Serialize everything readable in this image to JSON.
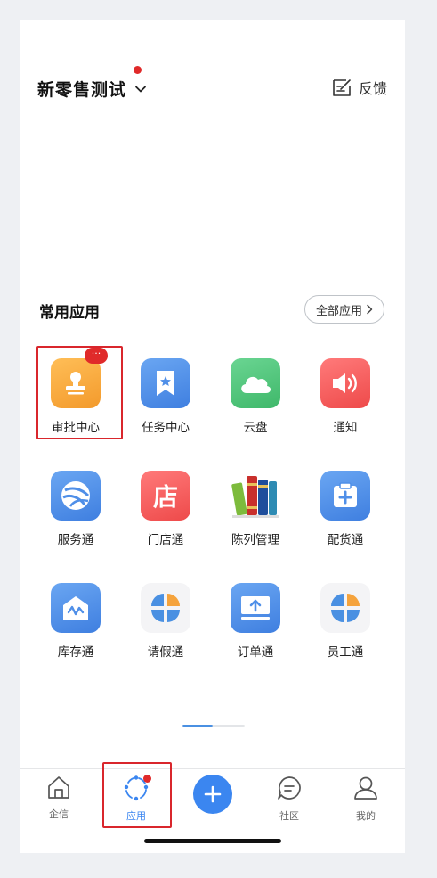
{
  "header": {
    "org_name": "新零售测试",
    "feedback_label": "反馈"
  },
  "section": {
    "title": "常用应用",
    "all_apps_label": "全部应用"
  },
  "apps": [
    {
      "label": "审批中心",
      "icon": "approval-stamp-icon",
      "color": "#f5a73c",
      "badge": "···"
    },
    {
      "label": "任务中心",
      "icon": "task-bookmark-icon",
      "color": "#4f8fe8"
    },
    {
      "label": "云盘",
      "icon": "cloud-icon",
      "color": "#52c47d"
    },
    {
      "label": "通知",
      "icon": "speaker-icon",
      "color": "#f25a5a"
    },
    {
      "label": "服务通",
      "icon": "service-globe-icon",
      "color": "#4f8fe8"
    },
    {
      "label": "门店通",
      "icon": "store-icon",
      "color": "#f25a5a",
      "glyph": "店"
    },
    {
      "label": "陈列管理",
      "icon": "books-icon",
      "color": "#ffffff"
    },
    {
      "label": "配货通",
      "icon": "delivery-box-icon",
      "color": "#4f8fe8"
    },
    {
      "label": "库存通",
      "icon": "warehouse-icon",
      "color": "#4f8fe8"
    },
    {
      "label": "请假通",
      "icon": "apps-grid-icon",
      "color": "#f4f4f6"
    },
    {
      "label": "订单通",
      "icon": "order-upload-icon",
      "color": "#4f8fe8"
    },
    {
      "label": "员工通",
      "icon": "apps-grid-icon",
      "color": "#f4f4f6"
    }
  ],
  "tabbar": {
    "tabs": [
      {
        "label": "企信",
        "icon": "home-icon"
      },
      {
        "label": "应用",
        "icon": "apps-orbit-icon",
        "active": true
      },
      {
        "label": "",
        "icon": "plus-icon"
      },
      {
        "label": "社区",
        "icon": "chat-bubble-icon"
      },
      {
        "label": "我的",
        "icon": "person-icon"
      }
    ]
  }
}
